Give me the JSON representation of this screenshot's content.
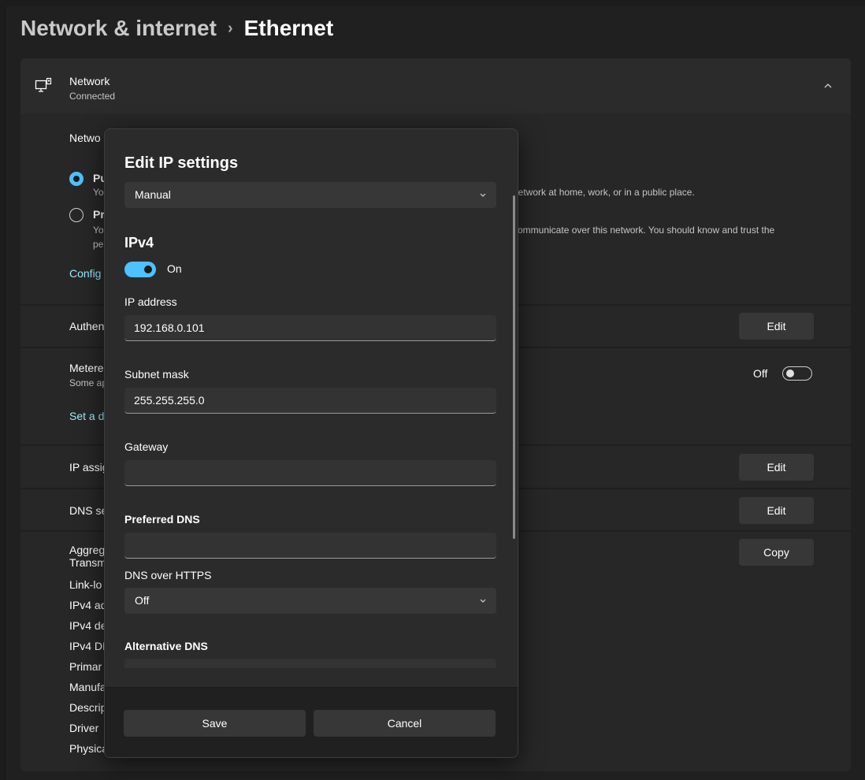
{
  "breadcrumb": {
    "parent": "Network & internet",
    "separator": "›",
    "current": "Ethernet"
  },
  "network_card": {
    "title": "Network",
    "status": "Connected"
  },
  "background": {
    "network_profile_label": "Netwo",
    "public_title": "Pu",
    "public_desc_start": "Yo",
    "public_desc_end": "network at home, work, or in a public place.",
    "private_title": "Pr",
    "private_desc_start": "Yo",
    "private_desc_end": "communicate over this network. You should know and trust the",
    "private_desc_line2": "pe",
    "configure_link": "Config",
    "authentication": "Authen",
    "metered": "Metere",
    "metered_sub": "Some ap",
    "metered_toggle_label": "Off",
    "set_data_limit": "Set a d",
    "ip_assignment": "IP assig",
    "dns_server": "DNS se",
    "edit_label": "Edit",
    "copy_label": "Copy",
    "properties": [
      "Aggreg",
      "Transm",
      "Link-lo",
      "IPv4 ad",
      "IPv4 de",
      "IPv4 DI",
      "Primar",
      "Manufa",
      "Descrip",
      "Driver",
      "Physica"
    ]
  },
  "dialog": {
    "title": "Edit IP settings",
    "mode": "Manual",
    "section": "IPv4",
    "ipv4_toggle": "On",
    "ip_address_label": "IP address",
    "ip_address_value": "192.168.0.101",
    "subnet_label": "Subnet mask",
    "subnet_value": "255.255.255.0",
    "gateway_label": "Gateway",
    "gateway_value": "",
    "preferred_dns_label": "Preferred DNS",
    "preferred_dns_value": "",
    "doh_label": "DNS over HTTPS",
    "doh_value": "Off",
    "alt_dns_label": "Alternative DNS",
    "save_label": "Save",
    "cancel_label": "Cancel"
  },
  "colors": {
    "accent": "#4cc2ff",
    "link": "#99ebff",
    "background": "#202020",
    "card": "#272727",
    "dialog": "#2b2b2b"
  },
  "icons": [
    "ethernet-monitor-icon",
    "chevron-up-icon",
    "chevron-down-icon"
  ]
}
